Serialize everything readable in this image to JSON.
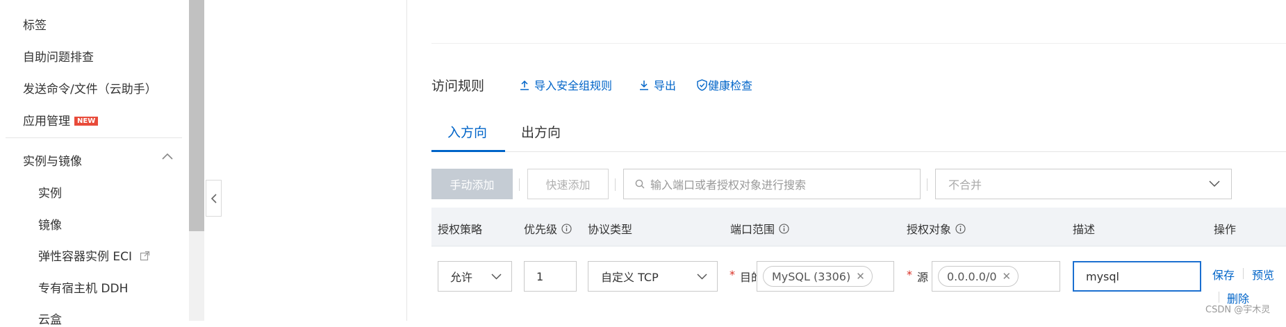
{
  "sidebar": {
    "items": [
      {
        "label": "标签"
      },
      {
        "label": "自助问题排查"
      },
      {
        "label": "发送命令/文件（云助手）"
      },
      {
        "label": "应用管理",
        "badge": "NEW"
      }
    ],
    "group": {
      "label": "实例与镜像",
      "expanded": true
    },
    "sub_items": [
      {
        "label": "实例"
      },
      {
        "label": "镜像"
      },
      {
        "label": "弹性容器实例 ECI",
        "external": true
      },
      {
        "label": "专有宿主机 DDH"
      },
      {
        "label": "云盒"
      }
    ]
  },
  "rules": {
    "title": "访问规则",
    "actions": [
      {
        "label": "导入安全组规则",
        "icon": "upload-icon"
      },
      {
        "label": "导出",
        "icon": "download-icon"
      },
      {
        "label": "健康检查",
        "icon": "shield-check-icon"
      }
    ],
    "tabs": [
      {
        "label": "入方向",
        "active": true
      },
      {
        "label": "出方向",
        "active": false
      }
    ],
    "toolbar": {
      "manual_add": "手动添加",
      "quick_add": "快速添加",
      "search_placeholder": "输入端口或者授权对象进行搜索",
      "merge_value": "不合并"
    },
    "columns": [
      "授权策略",
      "优先级",
      "协议类型",
      "端口范围",
      "授权对象",
      "描述",
      "操作"
    ],
    "row": {
      "policy": "允许",
      "priority": "1",
      "protocol": "自定义 TCP",
      "port_label": "目的",
      "port_tag": "MySQL (3306)",
      "source_label": "源",
      "source_tag": "0.0.0.0/0",
      "description": "mysql",
      "actions": {
        "save": "保存",
        "preview": "预览",
        "delete": "删除"
      }
    }
  },
  "watermark": "CSDN @宇木灵",
  "colors": {
    "accent": "#0064c8",
    "required": "#d93026",
    "badge": "#e84b3a"
  }
}
